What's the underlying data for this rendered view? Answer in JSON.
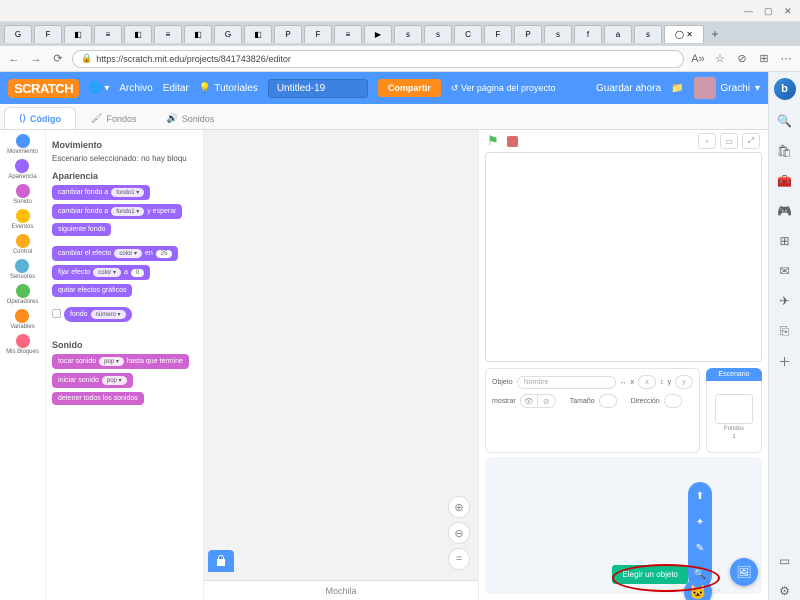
{
  "os_title": "",
  "browser": {
    "url": "https://scratch.mit.edu/projects/841743826/editor",
    "newtab": "+"
  },
  "scratch": {
    "logo": "SCRATCH",
    "menu": {
      "archivo": "Archivo",
      "editar": "Editar",
      "tutoriales": "Tutoriales"
    },
    "title": "Untitled-19",
    "compartir": "Compartir",
    "ver_pagina": "Ver página del proyecto",
    "guardar": "Guardar ahora",
    "user": "Grachi"
  },
  "tabs": {
    "codigo": "Código",
    "fondos": "Fondos",
    "sonidos": "Sonidos"
  },
  "categories": [
    {
      "name": "Movimiento",
      "color": "#4c97ff"
    },
    {
      "name": "Apariencia",
      "color": "#9966ff"
    },
    {
      "name": "Sonido",
      "color": "#cf63cf"
    },
    {
      "name": "Eventos",
      "color": "#ffbf00"
    },
    {
      "name": "Control",
      "color": "#ffab19"
    },
    {
      "name": "Sensores",
      "color": "#5cb1d6"
    },
    {
      "name": "Operadores",
      "color": "#59c059"
    },
    {
      "name": "Variables",
      "color": "#ff8c1a"
    },
    {
      "name": "Mis Bloques",
      "color": "#ff6680"
    }
  ],
  "palette": {
    "movimiento_h": "Movimiento",
    "escenario_note": "Escenario seleccionado: no hay bloqu",
    "apariencia_h": "Apariencia",
    "cambiar_fondo": "cambiar fondo a",
    "fondo1": "fondo1 ▾",
    "y_esperar": "y esperar",
    "siguiente_fondo": "siguiente fondo",
    "cambiar_efecto": "cambiar el efecto",
    "color_dd": "color ▾",
    "en": "en",
    "veinticinco": "25",
    "fijar_efecto": "fijar efecto",
    "a": "a",
    "cero": "0",
    "quitar_efectos": "quitar efectos gráficos",
    "fondo_num": "fondo",
    "numero_dd": "número ▾",
    "sonido_h": "Sonido",
    "tocar_sonido": "tocar sonido",
    "pop": "pop ▾",
    "hasta_termine": "hasta que termine",
    "iniciar_sonido": "iniciar sonido",
    "detener_sonidos": "detener todos los sonidos"
  },
  "mochila": "Mochila",
  "sprite_info": {
    "objeto": "Objeto",
    "nombre_ph": "Nombre",
    "x": "x",
    "y": "y",
    "mostrar": "mostrar",
    "tamano": "Tamaño",
    "direccion": "Dirección"
  },
  "stage_box": {
    "escenario": "Escenario",
    "fondos": "Fondos",
    "count": "1"
  },
  "fab": {
    "elegir": "Elegir un objeto"
  }
}
